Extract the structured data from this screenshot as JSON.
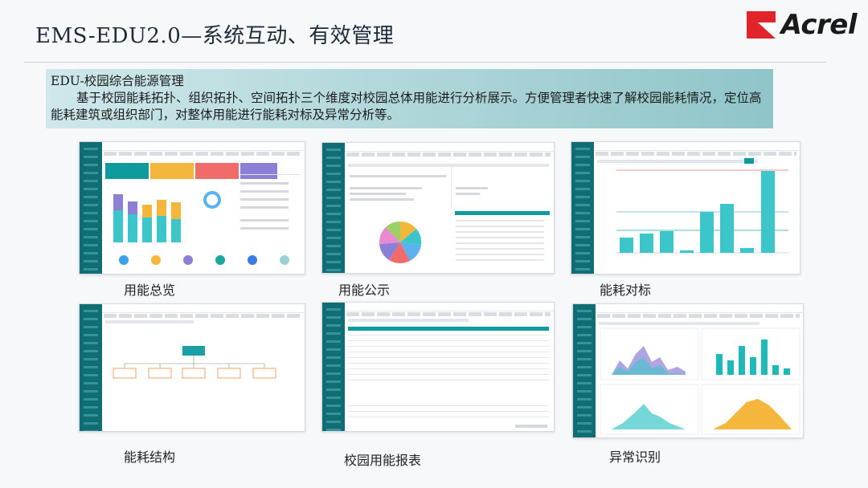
{
  "slide": {
    "title": "EMS-EDU2.0—系统互动、有效管理",
    "description": {
      "heading": "EDU-校园综合能源管理",
      "body": "基于校园能耗拓扑、组织拓扑、空间拓扑三个维度对校园总体用能进行分析展示。方便管理者快速了解校园能耗情况，定位高能耗建筑或组织部门，对整体用能进行能耗对标及异常分析等。"
    },
    "logo": {
      "text": "Acrel",
      "mark_color": "#e0242a"
    }
  },
  "panels": [
    {
      "id": "overview",
      "caption": "用能总览"
    },
    {
      "id": "publicity",
      "caption": "用能公示"
    },
    {
      "id": "benchmark",
      "caption": "能耗对标"
    },
    {
      "id": "structure",
      "caption": "能耗结构"
    },
    {
      "id": "report",
      "caption": "校园用能报表"
    },
    {
      "id": "anomaly",
      "caption": "异常识别"
    }
  ],
  "colors": {
    "teal": "#0f6e73",
    "bar": "#3cc6c9",
    "orange": "#f4b73c",
    "purple": "#8b7fd6",
    "red": "#f26b6b"
  }
}
